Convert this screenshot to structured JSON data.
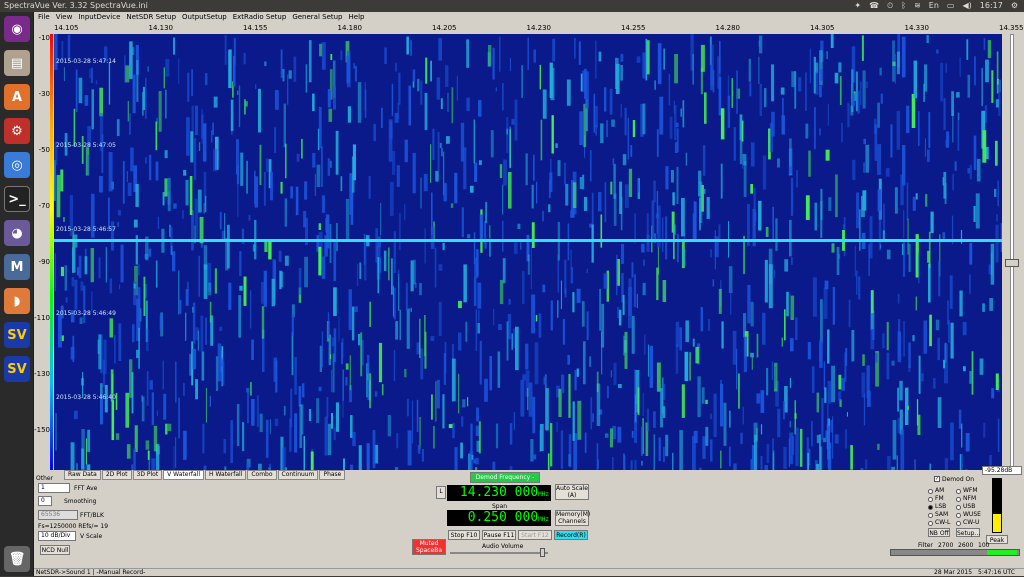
{
  "window": {
    "title": "SpectraVue Ver. 3.32   SpectraVue.ini"
  },
  "tray": {
    "time": "16:17",
    "lang": "En"
  },
  "menu": [
    "File",
    "View",
    "InputDevice",
    "NetSDR Setup",
    "OutputSetup",
    "ExtRadio Setup",
    "General Setup",
    "Help"
  ],
  "freq_ticks": [
    "14.105",
    "14.130",
    "14.155",
    "14.180",
    "14.205",
    "14.230",
    "14.255",
    "14.280",
    "14.305",
    "14.330",
    "14.355"
  ],
  "db_ticks": [
    "-10",
    "-30",
    "-50",
    "-70",
    "-90",
    "-110",
    "-130",
    "-150"
  ],
  "timestamps": [
    "2015-03-28 5:47:14",
    "2015-03-28 5:47:05",
    "2015-03-28 5:46:57",
    "2015-03-28 5:46:49",
    "2015-03-28 5:46:40"
  ],
  "tabs": [
    "Raw Data",
    "2D Plot",
    "3D Plot",
    "V Waterfall",
    "H Waterfall",
    "Combo",
    "Continuum",
    "Phase"
  ],
  "controls": {
    "other": "Other",
    "fft_ave_value": "1",
    "fft_ave_label": "FFT Ave",
    "smoothing_value": "0",
    "smoothing_label": "Smoothing",
    "fft_blk_value": "65536",
    "fft_blk_label": "FFT/BLK",
    "fs_info": "Fs=1250000 REfs/= 19",
    "vscale_value": "10 dB/Div",
    "vscale_label": "V Scale",
    "ncd_null": "NCD Null"
  },
  "demod": {
    "freq_button": "Demod Frequency - Inc",
    "l_button": "L",
    "freq_value": "14.230 000",
    "freq_unit": "MHz",
    "span_label": "Span",
    "span_value": "0.250 000",
    "span_unit": "MHz",
    "auto_scale": "Auto Scale (A)",
    "memory": "Memory(M) Channels",
    "muted": "Muted SpaceBa",
    "stop": "Stop F10",
    "pause": "Pause F11",
    "start": "Start F12",
    "record": "Record(R)",
    "audio_volume": "Audio Volume"
  },
  "modes": {
    "demod_on": "Demod On",
    "left": [
      "AM",
      "FM",
      "LSB",
      "SAM",
      "CW-L"
    ],
    "right": [
      "WFM",
      "NFM",
      "USB",
      "WUSE",
      "CW-U"
    ],
    "selected": "LSB",
    "nb_off": "NB Off",
    "setup": "Setup...",
    "peak": "Peak",
    "level": "-95.28dB",
    "filter_label": "Filter",
    "filter_values": [
      "2700",
      "2600",
      "100"
    ]
  },
  "statusbar": {
    "text": "NetSDR->Sound 1  | -Manual Record-",
    "date": "28 Mar 2015",
    "clock": "5:47:16 UTC"
  },
  "colors": {
    "waterfall_bg": "#0a1a8a",
    "signal_green": "#33dd55",
    "lcd_text": "#00ff00",
    "record_cyan": "#33ddee",
    "muted_red": "#ee3333"
  }
}
